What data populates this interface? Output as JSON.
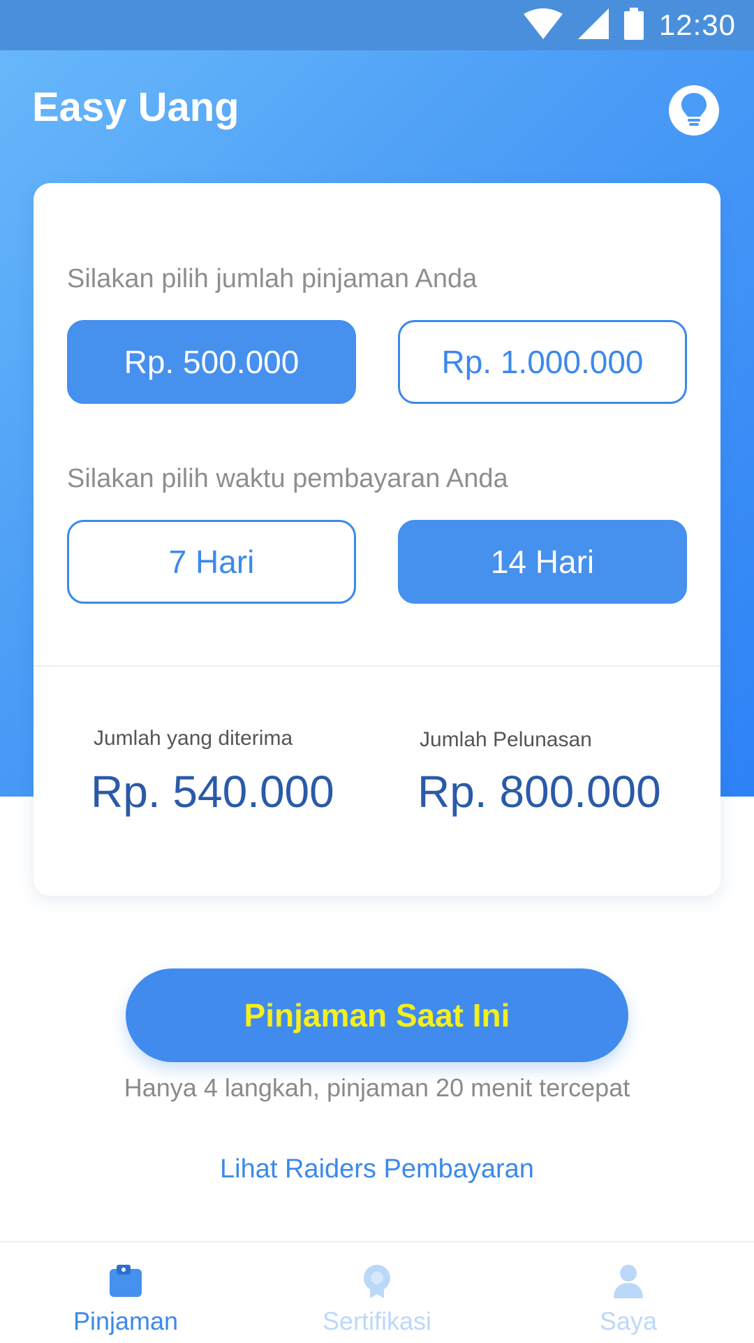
{
  "status_bar": {
    "time": "12:30",
    "icons": [
      "wifi-icon",
      "cellular-signal-icon",
      "battery-icon"
    ]
  },
  "header": {
    "title": "Easy Uang",
    "tip_icon": "lightbulb-icon"
  },
  "loan_form": {
    "amount_prompt": "Silakan pilih jumlah pinjaman Anda",
    "amount_options": [
      {
        "label": "Rp. 500.000",
        "selected": true
      },
      {
        "label": "Rp. 1.000.000",
        "selected": false
      }
    ],
    "term_prompt": "Silakan pilih waktu pembayaran Anda",
    "term_options": [
      {
        "label": "7 Hari",
        "selected": false
      },
      {
        "label": "14 Hari",
        "selected": true
      }
    ],
    "received_label": "Jumlah yang diterima",
    "received_value": "Rp. 540.000",
    "repayment_label": "Jumlah Pelunasan",
    "repayment_value": "Rp. 800.000"
  },
  "cta": {
    "label": "Pinjaman Saat Ini",
    "subtitle": "Hanya 4 langkah, pinjaman 20 menit tercepat"
  },
  "link": {
    "label": "Lihat Raiders Pembayaran"
  },
  "bottom_nav": {
    "items": [
      {
        "label": "Pinjaman",
        "icon": "wallet-icon",
        "active": true
      },
      {
        "label": "Sertifikasi",
        "icon": "certificate-icon",
        "active": false
      },
      {
        "label": "Saya",
        "icon": "user-icon",
        "active": false
      }
    ]
  },
  "colors": {
    "primary": "#4690ee",
    "cta_text": "#f5ef1c",
    "value_text": "#2a5aa8",
    "nav_inactive": "#bcd8f8"
  }
}
